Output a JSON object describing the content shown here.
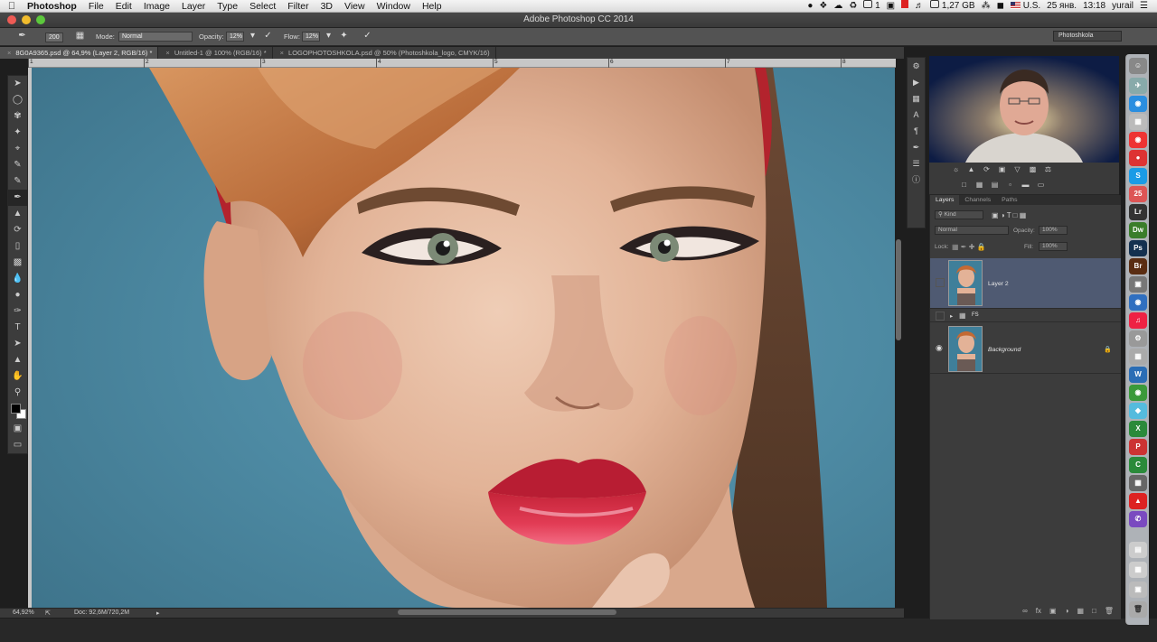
{
  "menubar": {
    "app": "Photoshop",
    "items": [
      "File",
      "Edit",
      "Image",
      "Layer",
      "Type",
      "Select",
      "Filter",
      "3D",
      "View",
      "Window",
      "Help"
    ],
    "status_i": "1",
    "memory": "1,27 GB",
    "locale": "U.S.",
    "date": "25 янв.",
    "time": "13:18",
    "user": "yurail"
  },
  "window": {
    "title": "Adobe Photoshop CC 2014"
  },
  "options": {
    "brush_size": "200",
    "mode_label": "Mode:",
    "mode_value": "Normal",
    "opacity_label": "Opacity:",
    "opacity_value": "12%",
    "flow_label": "Flow:",
    "flow_value": "12%",
    "workspace": "Photoshkola"
  },
  "tabs": [
    "8G0A9365.psd @ 64,9% (Layer 2, RGB/16) *",
    "Untitled-1 @ 100% (RGB/16) *",
    "LOGOPHOTOSHKOLA.psd @ 50% (Photoshkola_logo, CMYK/16)"
  ],
  "ruler": [
    "1",
    "2",
    "3",
    "4",
    "5",
    "6",
    "7",
    "8"
  ],
  "status": {
    "zoom": "64,92%",
    "doc": "Doc: 92,6M/720,2M"
  },
  "layers_panel": {
    "tabs": [
      "Layers",
      "Channels",
      "Paths"
    ],
    "kind": "Kind",
    "blend": "Normal",
    "opacity_label": "Opacity:",
    "opacity_value": "100%",
    "lock_label": "Lock:",
    "fill_label": "Fill:",
    "fill_value": "100%",
    "layers": [
      {
        "name": "Layer 2",
        "selected": true
      },
      {
        "name": "FS",
        "group": true
      },
      {
        "name": "Background",
        "locked": true
      }
    ]
  },
  "colors": {
    "canvas_bg": "#4d8aa3",
    "selected_layer": "#4f5a72",
    "panel": "#3c3c3c"
  }
}
